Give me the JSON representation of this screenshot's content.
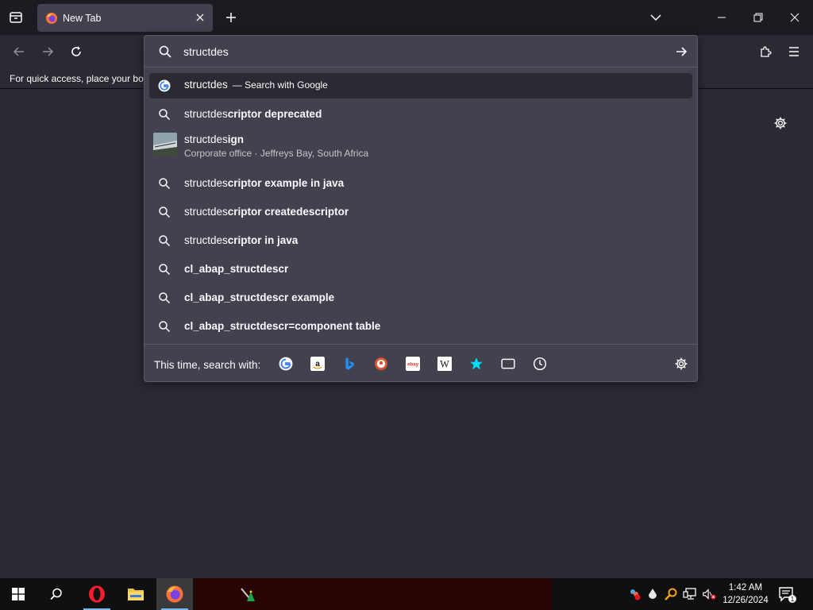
{
  "browser": {
    "tab": {
      "title": "New Tab"
    },
    "bookmarks_hint": "For quick access, place your boo"
  },
  "urlbar": {
    "query": "structdes",
    "results": [
      {
        "kind": "search-engine",
        "typed": "structdes",
        "suffix": "",
        "action": "— Search with Google",
        "icon": "google-icon",
        "selected": true
      },
      {
        "kind": "suggestion",
        "typed": "structdes",
        "suffix": "criptor deprecated",
        "icon": "search-icon"
      },
      {
        "kind": "place",
        "typed": "structdes",
        "suffix": "ign",
        "subtitle": "Corporate office · Jeffreys Bay, South Africa",
        "icon": "place-thumbnail"
      },
      {
        "kind": "suggestion",
        "typed": "structdes",
        "suffix": "criptor example in java",
        "icon": "search-icon"
      },
      {
        "kind": "suggestion",
        "typed": "structdes",
        "suffix": "criptor createdescriptor",
        "icon": "search-icon"
      },
      {
        "kind": "suggestion",
        "typed": "structdes",
        "suffix": "criptor in java",
        "icon": "search-icon"
      },
      {
        "kind": "suggestion",
        "typed": "",
        "suffix": "cl_abap_structdescr",
        "icon": "search-icon"
      },
      {
        "kind": "suggestion",
        "typed": "",
        "suffix": "cl_abap_structdescr example",
        "icon": "search-icon"
      },
      {
        "kind": "suggestion",
        "typed": "",
        "suffix": "cl_abap_structdescr=component table",
        "icon": "search-icon"
      }
    ],
    "one_off": {
      "label": "This time, search with:",
      "engines": [
        "google-icon",
        "amazon-icon",
        "bing-icon",
        "duckduckgo-icon",
        "ebay-icon",
        "wikipedia-icon",
        "bookmarks-star-icon",
        "tabs-icon",
        "history-clock-icon"
      ]
    }
  },
  "taskbar": {
    "time": "1:42 AM",
    "date": "12/26/2024",
    "notification_count": "1"
  },
  "colors": {
    "titlebar": "#1c1b22",
    "toolbar": "#2b2a33",
    "popup": "#42414d",
    "accent": "#76b9ed"
  }
}
